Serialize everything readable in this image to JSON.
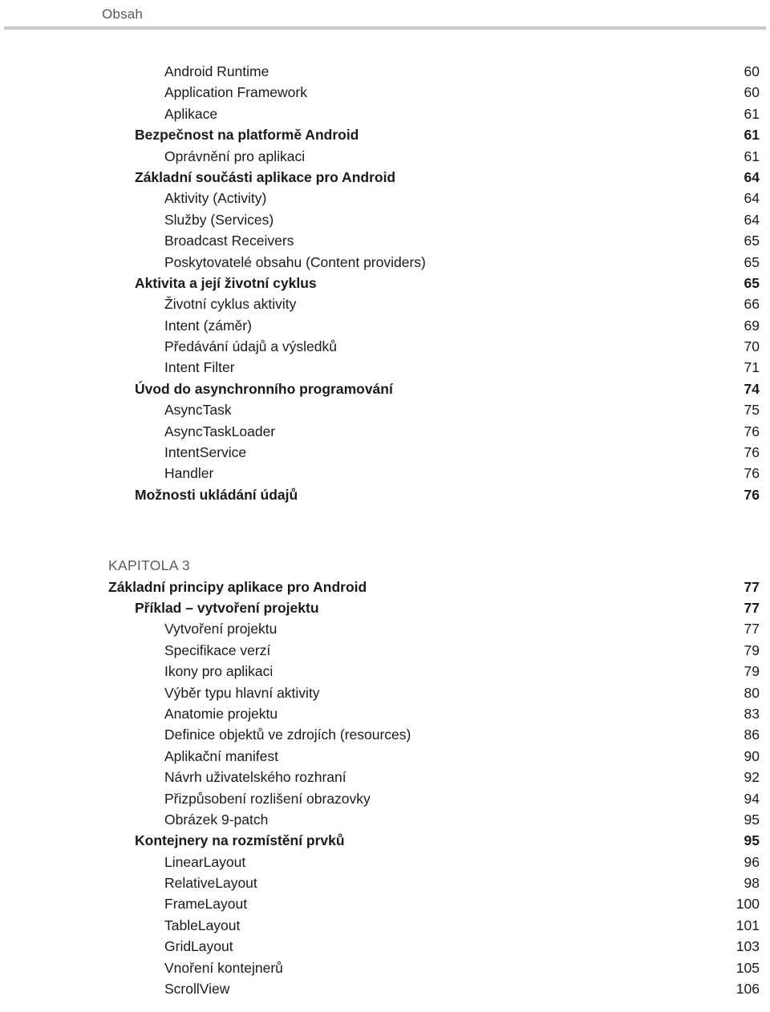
{
  "running_head": {
    "text": "Obsah",
    "rule_color": "#c9cacb",
    "text_color": "#58585a"
  },
  "toc": {
    "rows": [
      {
        "label": "Android Runtime",
        "page": "60",
        "level": 2,
        "bold": false,
        "kind": "entry"
      },
      {
        "label": "Application Framework",
        "page": "60",
        "level": 2,
        "bold": false,
        "kind": "entry"
      },
      {
        "label": "Aplikace",
        "page": "61",
        "level": 2,
        "bold": false,
        "kind": "entry"
      },
      {
        "label": "Bezpečnost na platformě Android",
        "page": "61",
        "level": 1,
        "bold": true,
        "kind": "entry"
      },
      {
        "label": "Oprávnění pro aplikaci",
        "page": "61",
        "level": 2,
        "bold": false,
        "kind": "entry"
      },
      {
        "label": "Základní součásti aplikace pro Android",
        "page": "64",
        "level": 1,
        "bold": true,
        "kind": "entry"
      },
      {
        "label": "Aktivity (Activity)",
        "page": "64",
        "level": 2,
        "bold": false,
        "kind": "entry"
      },
      {
        "label": "Služby (Services)",
        "page": "64",
        "level": 2,
        "bold": false,
        "kind": "entry"
      },
      {
        "label": "Broadcast Receivers",
        "page": "65",
        "level": 2,
        "bold": false,
        "kind": "entry"
      },
      {
        "label": "Poskytovatelé obsahu (Content providers)",
        "page": "65",
        "level": 2,
        "bold": false,
        "kind": "entry"
      },
      {
        "label": "Aktivita a její životní cyklus",
        "page": "65",
        "level": 1,
        "bold": true,
        "kind": "entry"
      },
      {
        "label": "Životní cyklus aktivity",
        "page": "66",
        "level": 2,
        "bold": false,
        "kind": "entry"
      },
      {
        "label": "Intent (záměr)",
        "page": "69",
        "level": 2,
        "bold": false,
        "kind": "entry"
      },
      {
        "label": "Předávání údajů a výsledků",
        "page": "70",
        "level": 2,
        "bold": false,
        "kind": "entry"
      },
      {
        "label": "Intent Filter",
        "page": "71",
        "level": 2,
        "bold": false,
        "kind": "entry"
      },
      {
        "label": "Úvod do asynchronního programování",
        "page": "74",
        "level": 1,
        "bold": true,
        "kind": "entry"
      },
      {
        "label": "AsyncTask",
        "page": "75",
        "level": 2,
        "bold": false,
        "kind": "entry"
      },
      {
        "label": "AsyncTaskLoader",
        "page": "76",
        "level": 2,
        "bold": false,
        "kind": "entry"
      },
      {
        "label": "IntentService",
        "page": "76",
        "level": 2,
        "bold": false,
        "kind": "entry"
      },
      {
        "label": "Handler",
        "page": "76",
        "level": 2,
        "bold": false,
        "kind": "entry"
      },
      {
        "label": "Možnosti ukládání údajů",
        "page": "76",
        "level": 1,
        "bold": true,
        "kind": "entry"
      },
      {
        "label": "",
        "page": "",
        "level": 0,
        "bold": false,
        "kind": "gap"
      },
      {
        "label": "KAPITOLA 3",
        "page": "",
        "level": 0,
        "bold": false,
        "kind": "chapter-label"
      },
      {
        "label": "Základní principy aplikace pro Android",
        "page": "77",
        "level": 0,
        "bold": true,
        "kind": "entry"
      },
      {
        "label": "Příklad – vytvoření projektu",
        "page": "77",
        "level": 1,
        "bold": true,
        "kind": "entry"
      },
      {
        "label": "Vytvoření projektu",
        "page": "77",
        "level": 2,
        "bold": false,
        "kind": "entry"
      },
      {
        "label": "Specifikace verzí",
        "page": "79",
        "level": 2,
        "bold": false,
        "kind": "entry"
      },
      {
        "label": "Ikony pro aplikaci",
        "page": "79",
        "level": 2,
        "bold": false,
        "kind": "entry"
      },
      {
        "label": "Výběr typu hlavní aktivity",
        "page": "80",
        "level": 2,
        "bold": false,
        "kind": "entry"
      },
      {
        "label": "Anatomie projektu",
        "page": "83",
        "level": 2,
        "bold": false,
        "kind": "entry"
      },
      {
        "label": "Definice objektů ve zdrojích (resources)",
        "page": "86",
        "level": 2,
        "bold": false,
        "kind": "entry"
      },
      {
        "label": "Aplikační manifest",
        "page": "90",
        "level": 2,
        "bold": false,
        "kind": "entry"
      },
      {
        "label": "Návrh uživatelského rozhraní",
        "page": "92",
        "level": 2,
        "bold": false,
        "kind": "entry"
      },
      {
        "label": "Přizpůsobení rozlišení obrazovky",
        "page": "94",
        "level": 2,
        "bold": false,
        "kind": "entry"
      },
      {
        "label": "Obrázek 9-patch",
        "page": "95",
        "level": 2,
        "bold": false,
        "kind": "entry"
      },
      {
        "label": "Kontejnery na rozmístění prvků",
        "page": "95",
        "level": 1,
        "bold": true,
        "kind": "entry"
      },
      {
        "label": "LinearLayout",
        "page": "96",
        "level": 2,
        "bold": false,
        "kind": "entry"
      },
      {
        "label": "RelativeLayout",
        "page": "98",
        "level": 2,
        "bold": false,
        "kind": "entry"
      },
      {
        "label": "FrameLayout",
        "page": "100",
        "level": 2,
        "bold": false,
        "kind": "entry"
      },
      {
        "label": "TableLayout",
        "page": "101",
        "level": 2,
        "bold": false,
        "kind": "entry"
      },
      {
        "label": "GridLayout",
        "page": "103",
        "level": 2,
        "bold": false,
        "kind": "entry"
      },
      {
        "label": "Vnoření kontejnerů",
        "page": "105",
        "level": 2,
        "bold": false,
        "kind": "entry"
      },
      {
        "label": "ScrollView",
        "page": "106",
        "level": 2,
        "bold": false,
        "kind": "entry"
      }
    ]
  }
}
